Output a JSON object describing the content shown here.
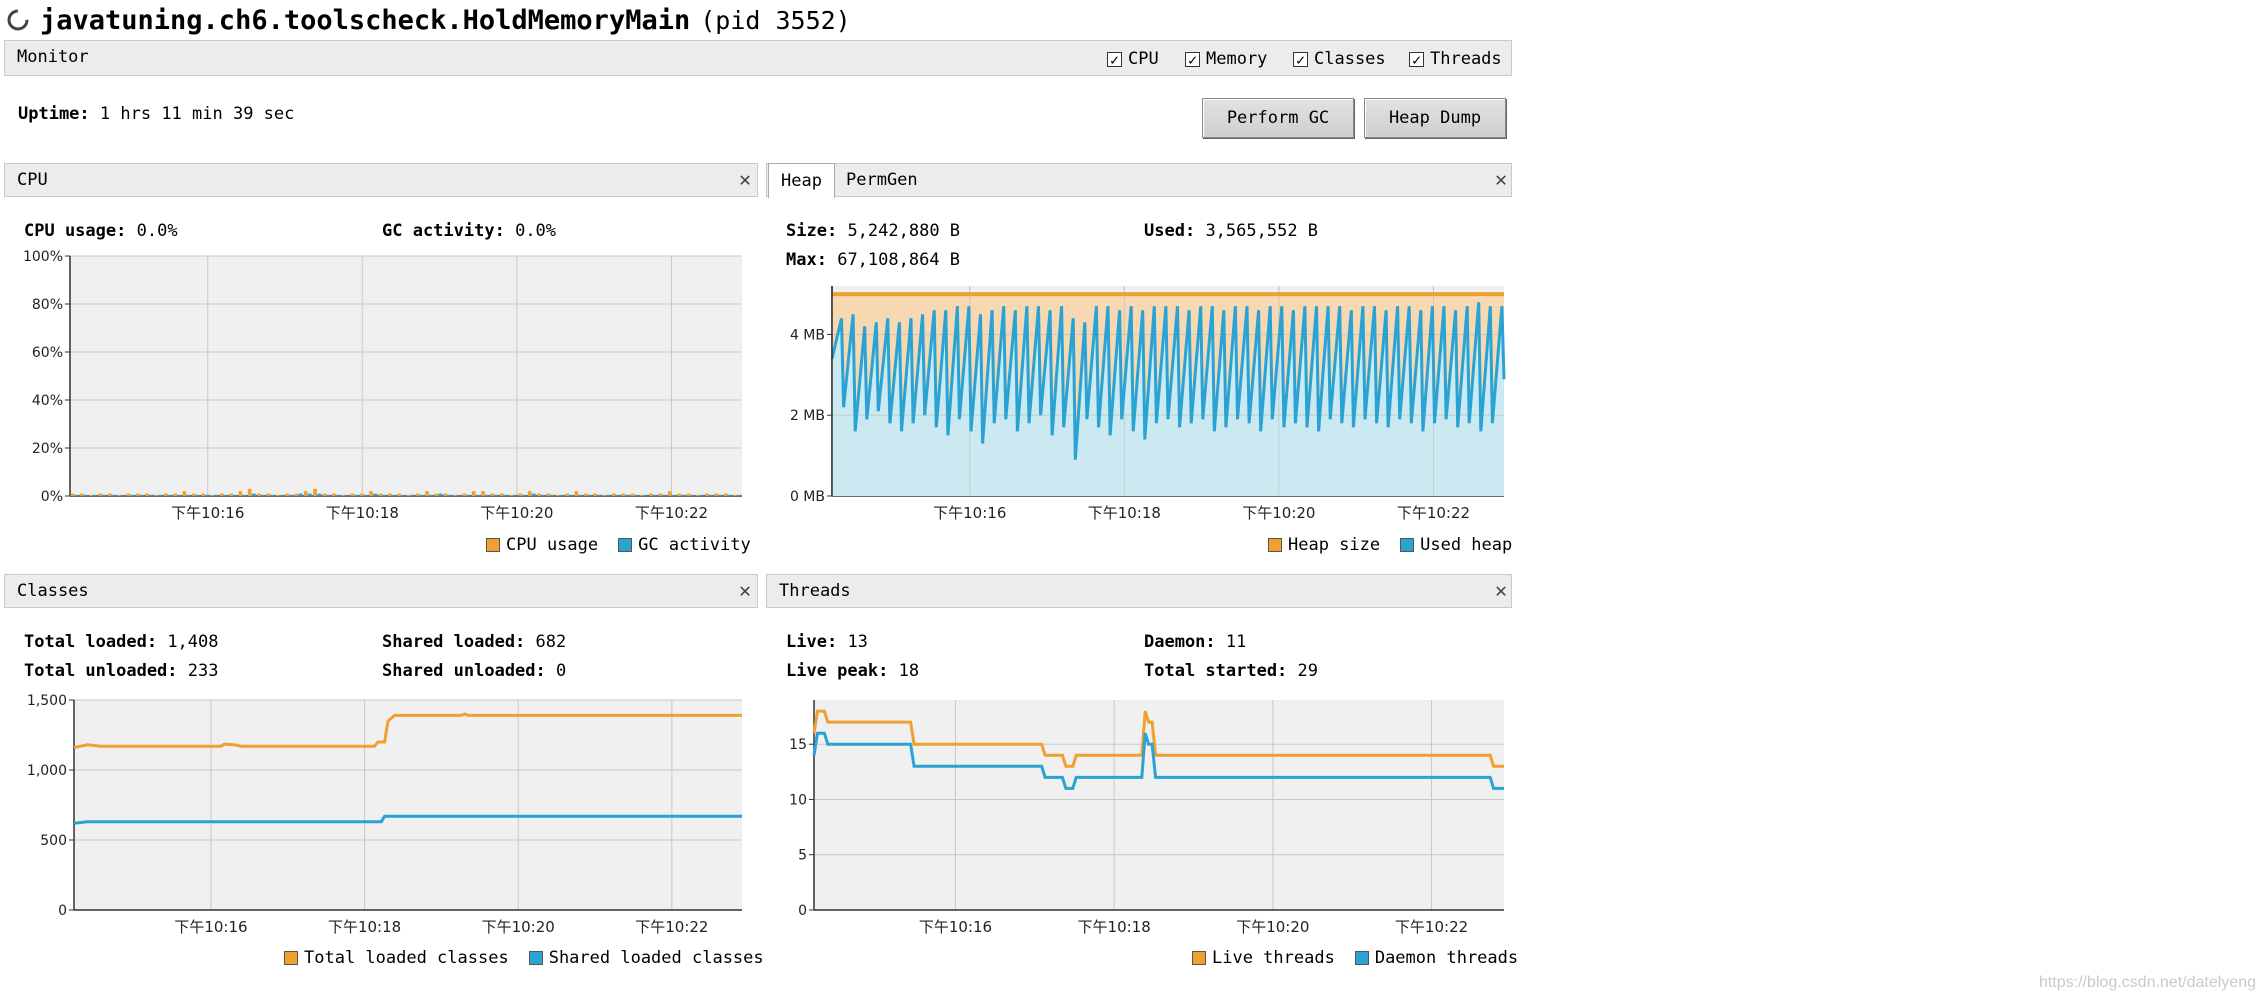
{
  "window": {
    "title": "javatuning.ch6.toolscheck.HoldMemoryMain",
    "pid_label": "(pid 3552)"
  },
  "monitor": {
    "title": "Monitor",
    "checkboxes": [
      {
        "label": "CPU",
        "checked": true
      },
      {
        "label": "Memory",
        "checked": true
      },
      {
        "label": "Classes",
        "checked": true
      },
      {
        "label": "Threads",
        "checked": true
      }
    ],
    "uptime_key": "Uptime:",
    "uptime_value": "1 hrs 11 min 39 sec",
    "perform_gc": "Perform GC",
    "heap_dump": "Heap Dump"
  },
  "cpu": {
    "title": "CPU",
    "usage_key": "CPU usage:",
    "usage_value": "0.0%",
    "gc_key": "GC activity:",
    "gc_value": "0.0%",
    "legend": [
      "CPU usage",
      "GC activity"
    ]
  },
  "heap": {
    "tabs": [
      "Heap",
      "PermGen"
    ],
    "size_key": "Size:",
    "size_value": "5,242,880 B",
    "used_key": "Used:",
    "used_value": "3,565,552 B",
    "max_key": "Max:",
    "max_value": "67,108,864 B",
    "legend": [
      "Heap size",
      "Used heap"
    ]
  },
  "classes": {
    "title": "Classes",
    "total_loaded_key": "Total loaded:",
    "total_loaded_value": "1,408",
    "shared_loaded_key": "Shared loaded:",
    "shared_loaded_value": "682",
    "total_unloaded_key": "Total unloaded:",
    "total_unloaded_value": "233",
    "shared_unloaded_key": "Shared unloaded:",
    "shared_unloaded_value": "0",
    "legend": [
      "Total loaded classes",
      "Shared loaded classes"
    ]
  },
  "threads": {
    "title": "Threads",
    "live_key": "Live:",
    "live_value": "13",
    "daemon_key": "Daemon:",
    "daemon_value": "11",
    "peak_key": "Live peak:",
    "peak_value": "18",
    "started_key": "Total started:",
    "started_value": "29",
    "legend": [
      "Live threads",
      "Daemon threads"
    ]
  },
  "colors": {
    "orange": "#f0a030",
    "blue": "#2aa3d4",
    "orange_fill": "#f7d3a8",
    "blue_fill": "#c7ebf7",
    "plot_bg": "#f0f0f0",
    "grid": "#c8c8c8"
  },
  "watermark": "https://blog.csdn.net/datelyeng",
  "chart_data": [
    {
      "type": "bar",
      "title": "CPU",
      "x_ticks": [
        "下午10:16",
        "下午10:18",
        "下午10:20",
        "下午10:22"
      ],
      "y_ticks": [
        "100%",
        "80%",
        "60%",
        "40%",
        "20%",
        "0%"
      ],
      "ylim": [
        0,
        100
      ],
      "series": [
        {
          "name": "CPU usage",
          "values": [
            1,
            1,
            0.5,
            1,
            1,
            0.5,
            1,
            1,
            1,
            0.5,
            1,
            1,
            2,
            1,
            1,
            0.5,
            1,
            1,
            2,
            3,
            1,
            1,
            0.5,
            1,
            1,
            2,
            3,
            1,
            1,
            0.5,
            1,
            1,
            2,
            1,
            1,
            1,
            0.5,
            1,
            2,
            1,
            1,
            0.5,
            1,
            2,
            2,
            1,
            1,
            0.5,
            1,
            2,
            1,
            1,
            0.5,
            1,
            2,
            1,
            1,
            0.5,
            1,
            1,
            1,
            0.5,
            1,
            1,
            2,
            1,
            1,
            0.5,
            1,
            1,
            1,
            0.5
          ]
        },
        {
          "name": "GC activity",
          "values": [
            0.5,
            0.5,
            0.5,
            0.5,
            0.5,
            0.5,
            0.5,
            0.5,
            0.5,
            0.5,
            0.5,
            0.5,
            0.5,
            0.5,
            0.5,
            0.5,
            0.5,
            0.5,
            0.5,
            1,
            0.5,
            0.5,
            0.5,
            0.5,
            1,
            1,
            1,
            0.5,
            0.5,
            0.5,
            0.5,
            0.5,
            1,
            0.5,
            0.5,
            0.5,
            0.5,
            0.5,
            0.5,
            1,
            0.5,
            0.5,
            0.5,
            0.5,
            0.5,
            0.5,
            0.5,
            0.5,
            0.5,
            1,
            0.5,
            0.5,
            0.5,
            0.5,
            0.5,
            0.5,
            0.5,
            0.5,
            0.5,
            0.5,
            0.5,
            0.5,
            0.5,
            0.5,
            0.5,
            0.5,
            0.5,
            0.5,
            0.5,
            0.5,
            0.5,
            0.5
          ]
        }
      ]
    },
    {
      "type": "area",
      "title": "Heap",
      "x_ticks": [
        "下午10:16",
        "下午10:18",
        "下午10:20",
        "下午10:22"
      ],
      "y_ticks": [
        "4 MB",
        "2 MB",
        "0 MB"
      ],
      "ylim": [
        0,
        5.2
      ],
      "series": [
        {
          "name": "Heap size",
          "values": [
            5.0,
            5.0
          ]
        },
        {
          "name": "Used heap",
          "sawtooth": {
            "cycles": 58,
            "min": [
              3.4,
              2.2,
              1.6,
              1.9,
              2.1,
              1.8,
              1.6,
              1.8,
              2.0,
              1.7,
              1.5,
              1.9,
              1.6,
              1.3,
              1.8,
              1.9,
              1.6,
              1.8,
              2.0,
              1.5,
              1.7,
              0.9,
              1.9,
              1.7,
              1.5,
              1.9,
              1.6,
              1.4,
              1.8,
              1.9,
              1.7,
              1.8,
              1.9,
              1.6,
              1.7,
              1.9,
              1.8,
              1.6,
              1.9,
              1.7,
              1.8,
              1.7,
              1.6,
              1.9,
              1.8,
              1.7,
              1.9,
              1.8,
              1.7,
              1.9,
              1.8,
              1.6,
              1.8,
              1.9,
              1.7,
              1.8,
              1.6,
              1.8
            ],
            "max": [
              4.4,
              4.5,
              4.2,
              4.3,
              4.4,
              4.3,
              4.4,
              4.5,
              4.6,
              4.6,
              4.7,
              4.7,
              4.5,
              4.6,
              4.7,
              4.6,
              4.7,
              4.7,
              4.6,
              4.7,
              4.4,
              4.3,
              4.7,
              4.7,
              4.6,
              4.7,
              4.6,
              4.7,
              4.7,
              4.7,
              4.6,
              4.7,
              4.7,
              4.6,
              4.7,
              4.7,
              4.6,
              4.7,
              4.7,
              4.6,
              4.7,
              4.7,
              4.7,
              4.7,
              4.6,
              4.7,
              4.7,
              4.6,
              4.7,
              4.7,
              4.6,
              4.7,
              4.7,
              4.6,
              4.7,
              4.8,
              4.7,
              4.7
            ]
          }
        }
      ]
    },
    {
      "type": "line",
      "title": "Classes",
      "x_ticks": [
        "下午10:16",
        "下午10:18",
        "下午10:20",
        "下午10:22"
      ],
      "y_ticks": [
        "1,500",
        "1,000",
        "500",
        "0"
      ],
      "ylim": [
        0,
        1500
      ],
      "series": [
        {
          "name": "Total loaded classes",
          "points": [
            [
              0,
              1160
            ],
            [
              0.02,
              1180
            ],
            [
              0.04,
              1170
            ],
            [
              0.22,
              1170
            ],
            [
              0.225,
              1185
            ],
            [
              0.24,
              1180
            ],
            [
              0.25,
              1170
            ],
            [
              0.45,
              1170
            ],
            [
              0.455,
              1200
            ],
            [
              0.465,
              1200
            ],
            [
              0.47,
              1350
            ],
            [
              0.48,
              1390
            ],
            [
              0.58,
              1390
            ],
            [
              0.585,
              1400
            ],
            [
              0.59,
              1390
            ],
            [
              1,
              1390
            ]
          ]
        },
        {
          "name": "Shared loaded classes",
          "points": [
            [
              0,
              620
            ],
            [
              0.02,
              630
            ],
            [
              0.46,
              630
            ],
            [
              0.465,
              670
            ],
            [
              1,
              670
            ]
          ]
        }
      ]
    },
    {
      "type": "line",
      "title": "Threads",
      "x_ticks": [
        "下午10:16",
        "下午10:18",
        "下午10:20",
        "下午10:22"
      ],
      "y_ticks": [
        "15",
        "10",
        "5",
        "0"
      ],
      "ylim": [
        0,
        19
      ],
      "series": [
        {
          "name": "Live threads",
          "points": [
            [
              0,
              16
            ],
            [
              0.005,
              18
            ],
            [
              0.015,
              18
            ],
            [
              0.02,
              17
            ],
            [
              0.14,
              17
            ],
            [
              0.145,
              15
            ],
            [
              0.33,
              15
            ],
            [
              0.335,
              14
            ],
            [
              0.36,
              14
            ],
            [
              0.365,
              13
            ],
            [
              0.375,
              13
            ],
            [
              0.38,
              14
            ],
            [
              0.475,
              14
            ],
            [
              0.48,
              18
            ],
            [
              0.485,
              17
            ],
            [
              0.49,
              17
            ],
            [
              0.495,
              14
            ],
            [
              0.5,
              14
            ],
            [
              0.98,
              14
            ],
            [
              0.985,
              13
            ],
            [
              1,
              13
            ]
          ]
        },
        {
          "name": "Daemon threads",
          "points": [
            [
              0,
              14
            ],
            [
              0.005,
              16
            ],
            [
              0.015,
              16
            ],
            [
              0.02,
              15
            ],
            [
              0.14,
              15
            ],
            [
              0.145,
              13
            ],
            [
              0.33,
              13
            ],
            [
              0.335,
              12
            ],
            [
              0.36,
              12
            ],
            [
              0.365,
              11
            ],
            [
              0.375,
              11
            ],
            [
              0.38,
              12
            ],
            [
              0.475,
              12
            ],
            [
              0.48,
              16
            ],
            [
              0.485,
              15
            ],
            [
              0.49,
              15
            ],
            [
              0.495,
              12
            ],
            [
              0.5,
              12
            ],
            [
              0.98,
              12
            ],
            [
              0.985,
              11
            ],
            [
              1,
              11
            ]
          ]
        }
      ]
    }
  ]
}
